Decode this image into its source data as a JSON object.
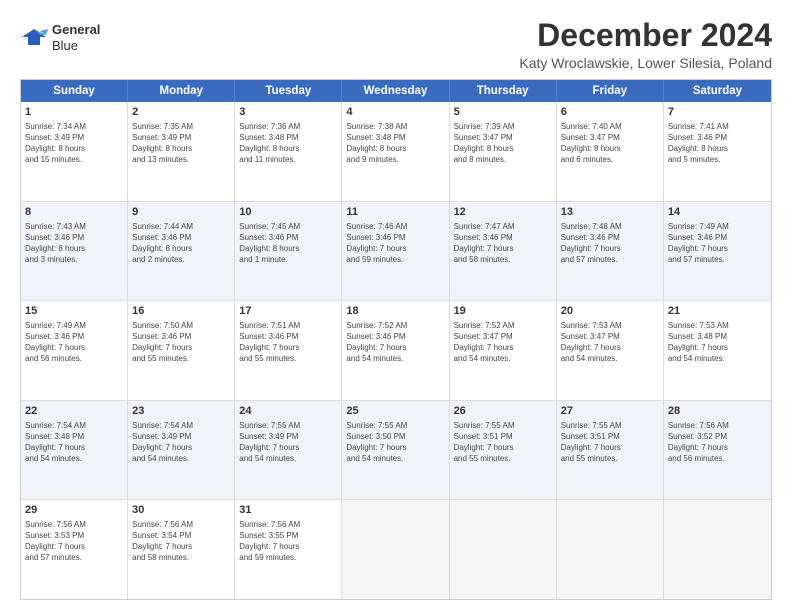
{
  "header": {
    "logo_line1": "General",
    "logo_line2": "Blue",
    "title": "December 2024",
    "subtitle": "Katy Wroclawskie, Lower Silesia, Poland"
  },
  "calendar": {
    "days": [
      "Sunday",
      "Monday",
      "Tuesday",
      "Wednesday",
      "Thursday",
      "Friday",
      "Saturday"
    ],
    "rows": [
      [
        {
          "day": "1",
          "lines": [
            "Sunrise: 7:34 AM",
            "Sunset: 3:49 PM",
            "Daylight: 8 hours",
            "and 15 minutes."
          ]
        },
        {
          "day": "2",
          "lines": [
            "Sunrise: 7:35 AM",
            "Sunset: 3:49 PM",
            "Daylight: 8 hours",
            "and 13 minutes."
          ]
        },
        {
          "day": "3",
          "lines": [
            "Sunrise: 7:36 AM",
            "Sunset: 3:48 PM",
            "Daylight: 8 hours",
            "and 11 minutes."
          ]
        },
        {
          "day": "4",
          "lines": [
            "Sunrise: 7:38 AM",
            "Sunset: 3:48 PM",
            "Daylight: 8 hours",
            "and 9 minutes."
          ]
        },
        {
          "day": "5",
          "lines": [
            "Sunrise: 7:39 AM",
            "Sunset: 3:47 PM",
            "Daylight: 8 hours",
            "and 8 minutes."
          ]
        },
        {
          "day": "6",
          "lines": [
            "Sunrise: 7:40 AM",
            "Sunset: 3:47 PM",
            "Daylight: 8 hours",
            "and 6 minutes."
          ]
        },
        {
          "day": "7",
          "lines": [
            "Sunrise: 7:41 AM",
            "Sunset: 3:46 PM",
            "Daylight: 8 hours",
            "and 5 minutes."
          ]
        }
      ],
      [
        {
          "day": "8",
          "lines": [
            "Sunrise: 7:43 AM",
            "Sunset: 3:46 PM",
            "Daylight: 8 hours",
            "and 3 minutes."
          ]
        },
        {
          "day": "9",
          "lines": [
            "Sunrise: 7:44 AM",
            "Sunset: 3:46 PM",
            "Daylight: 8 hours",
            "and 2 minutes."
          ]
        },
        {
          "day": "10",
          "lines": [
            "Sunrise: 7:45 AM",
            "Sunset: 3:46 PM",
            "Daylight: 8 hours",
            "and 1 minute."
          ]
        },
        {
          "day": "11",
          "lines": [
            "Sunrise: 7:46 AM",
            "Sunset: 3:46 PM",
            "Daylight: 7 hours",
            "and 59 minutes."
          ]
        },
        {
          "day": "12",
          "lines": [
            "Sunrise: 7:47 AM",
            "Sunset: 3:46 PM",
            "Daylight: 7 hours",
            "and 58 minutes."
          ]
        },
        {
          "day": "13",
          "lines": [
            "Sunrise: 7:48 AM",
            "Sunset: 3:46 PM",
            "Daylight: 7 hours",
            "and 57 minutes."
          ]
        },
        {
          "day": "14",
          "lines": [
            "Sunrise: 7:49 AM",
            "Sunset: 3:46 PM",
            "Daylight: 7 hours",
            "and 57 minutes."
          ]
        }
      ],
      [
        {
          "day": "15",
          "lines": [
            "Sunrise: 7:49 AM",
            "Sunset: 3:46 PM",
            "Daylight: 7 hours",
            "and 56 minutes."
          ]
        },
        {
          "day": "16",
          "lines": [
            "Sunrise: 7:50 AM",
            "Sunset: 3:46 PM",
            "Daylight: 7 hours",
            "and 55 minutes."
          ]
        },
        {
          "day": "17",
          "lines": [
            "Sunrise: 7:51 AM",
            "Sunset: 3:46 PM",
            "Daylight: 7 hours",
            "and 55 minutes."
          ]
        },
        {
          "day": "18",
          "lines": [
            "Sunrise: 7:52 AM",
            "Sunset: 3:46 PM",
            "Daylight: 7 hours",
            "and 54 minutes."
          ]
        },
        {
          "day": "19",
          "lines": [
            "Sunrise: 7:52 AM",
            "Sunset: 3:47 PM",
            "Daylight: 7 hours",
            "and 54 minutes."
          ]
        },
        {
          "day": "20",
          "lines": [
            "Sunrise: 7:53 AM",
            "Sunset: 3:47 PM",
            "Daylight: 7 hours",
            "and 54 minutes."
          ]
        },
        {
          "day": "21",
          "lines": [
            "Sunrise: 7:53 AM",
            "Sunset: 3:48 PM",
            "Daylight: 7 hours",
            "and 54 minutes."
          ]
        }
      ],
      [
        {
          "day": "22",
          "lines": [
            "Sunrise: 7:54 AM",
            "Sunset: 3:48 PM",
            "Daylight: 7 hours",
            "and 54 minutes."
          ]
        },
        {
          "day": "23",
          "lines": [
            "Sunrise: 7:54 AM",
            "Sunset: 3:49 PM",
            "Daylight: 7 hours",
            "and 54 minutes."
          ]
        },
        {
          "day": "24",
          "lines": [
            "Sunrise: 7:55 AM",
            "Sunset: 3:49 PM",
            "Daylight: 7 hours",
            "and 54 minutes."
          ]
        },
        {
          "day": "25",
          "lines": [
            "Sunrise: 7:55 AM",
            "Sunset: 3:50 PM",
            "Daylight: 7 hours",
            "and 54 minutes."
          ]
        },
        {
          "day": "26",
          "lines": [
            "Sunrise: 7:55 AM",
            "Sunset: 3:51 PM",
            "Daylight: 7 hours",
            "and 55 minutes."
          ]
        },
        {
          "day": "27",
          "lines": [
            "Sunrise: 7:55 AM",
            "Sunset: 3:51 PM",
            "Daylight: 7 hours",
            "and 55 minutes."
          ]
        },
        {
          "day": "28",
          "lines": [
            "Sunrise: 7:56 AM",
            "Sunset: 3:52 PM",
            "Daylight: 7 hours",
            "and 56 minutes."
          ]
        }
      ],
      [
        {
          "day": "29",
          "lines": [
            "Sunrise: 7:56 AM",
            "Sunset: 3:53 PM",
            "Daylight: 7 hours",
            "and 57 minutes."
          ]
        },
        {
          "day": "30",
          "lines": [
            "Sunrise: 7:56 AM",
            "Sunset: 3:54 PM",
            "Daylight: 7 hours",
            "and 58 minutes."
          ]
        },
        {
          "day": "31",
          "lines": [
            "Sunrise: 7:56 AM",
            "Sunset: 3:55 PM",
            "Daylight: 7 hours",
            "and 59 minutes."
          ]
        },
        {
          "day": "",
          "lines": []
        },
        {
          "day": "",
          "lines": []
        },
        {
          "day": "",
          "lines": []
        },
        {
          "day": "",
          "lines": []
        }
      ]
    ]
  }
}
